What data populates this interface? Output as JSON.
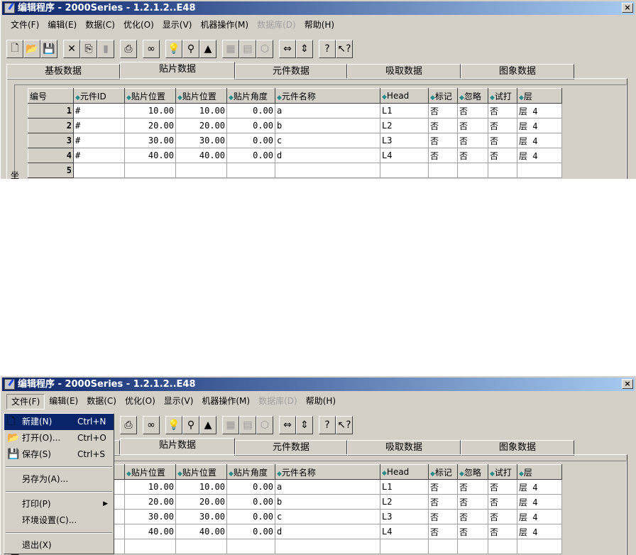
{
  "window": {
    "title": "编辑程序  - 2000Series - 1.2.1.2..E48",
    "close": "×"
  },
  "menubar": [
    {
      "label": "文件(F)"
    },
    {
      "label": "编辑(E)"
    },
    {
      "label": "数据(C)"
    },
    {
      "label": "优化(O)"
    },
    {
      "label": "显示(V)"
    },
    {
      "label": "机器操作(M)"
    },
    {
      "label": "数据库(D)",
      "disabled": true
    },
    {
      "label": "帮助(H)"
    }
  ],
  "toolbar": [
    {
      "icon": "new-file-icon",
      "glyph": "🗋"
    },
    {
      "icon": "open-folder-icon",
      "glyph": "📂"
    },
    {
      "icon": "save-icon",
      "glyph": "💾"
    },
    {
      "icon": "delete-icon",
      "glyph": "✕",
      "gap": true
    },
    {
      "icon": "copy-icon",
      "glyph": "⎘"
    },
    {
      "icon": "paste-icon",
      "glyph": "▮",
      "disabled": true
    },
    {
      "icon": "print-icon",
      "glyph": "⎙",
      "gap": true
    },
    {
      "icon": "find-icon",
      "glyph": "∞",
      "gap": true
    },
    {
      "icon": "lightbulb-icon",
      "glyph": "💡",
      "gap": true
    },
    {
      "icon": "magnify-tree-icon",
      "glyph": "⚲"
    },
    {
      "icon": "shapes-icon",
      "glyph": "▲"
    },
    {
      "icon": "component-icon",
      "glyph": "▦",
      "gap": true,
      "disabled": true
    },
    {
      "icon": "chip-icon",
      "glyph": "▤",
      "disabled": true
    },
    {
      "icon": "package-icon",
      "glyph": "⬡",
      "disabled": true
    },
    {
      "icon": "swap-horizontal-icon",
      "glyph": "⇔",
      "gap": true
    },
    {
      "icon": "swap-vertical-icon",
      "glyph": "⇕"
    },
    {
      "icon": "help-icon",
      "glyph": "?",
      "gap": true
    },
    {
      "icon": "context-help-icon",
      "glyph": "↖?"
    }
  ],
  "tabs": [
    {
      "label": "基板数据"
    },
    {
      "label": "贴片数据",
      "selected": true
    },
    {
      "label": "元件数据"
    },
    {
      "label": "吸取数据"
    },
    {
      "label": "图象数据"
    }
  ],
  "side_label": "坐",
  "table": {
    "columns": [
      "编号",
      "元件ID",
      "贴片位置",
      "贴片位置",
      "贴片角度",
      "元件名称",
      "Head",
      "标记",
      "忽略",
      "试打",
      "层"
    ],
    "rows": [
      [
        "1",
        "#",
        "10.00",
        "10.00",
        "0.00",
        "a",
        "L1",
        "否",
        "否",
        "否",
        "层 4"
      ],
      [
        "2",
        "#",
        "20.00",
        "20.00",
        "0.00",
        "b",
        "L2",
        "否",
        "否",
        "否",
        "层 4"
      ],
      [
        "3",
        "#",
        "30.00",
        "30.00",
        "0.00",
        "c",
        "L3",
        "否",
        "否",
        "否",
        "层 4"
      ],
      [
        "4",
        "#",
        "40.00",
        "40.00",
        "0.00",
        "d",
        "L4",
        "否",
        "否",
        "否",
        "层 4"
      ],
      [
        "5",
        "",
        "",
        "",
        "",
        "",
        "",
        "",
        "",
        "",
        ""
      ]
    ]
  },
  "file_menu": [
    {
      "label": "新建(N)",
      "shortcut": "Ctrl+N",
      "icon": "new-file-icon",
      "glyph": "🗋",
      "highlighted": true
    },
    {
      "label": "打开(O)...",
      "shortcut": "Ctrl+O",
      "icon": "open-folder-icon",
      "glyph": "📂"
    },
    {
      "label": "保存(S)",
      "shortcut": "Ctrl+S",
      "icon": "save-icon",
      "glyph": "💾"
    },
    {
      "separator": true
    },
    {
      "label": "另存为(A)..."
    },
    {
      "separator": true
    },
    {
      "label": "打印(P)",
      "submenu": true
    },
    {
      "label": "环境设置(C)..."
    },
    {
      "separator": true
    },
    {
      "label": "退出(X)"
    }
  ]
}
